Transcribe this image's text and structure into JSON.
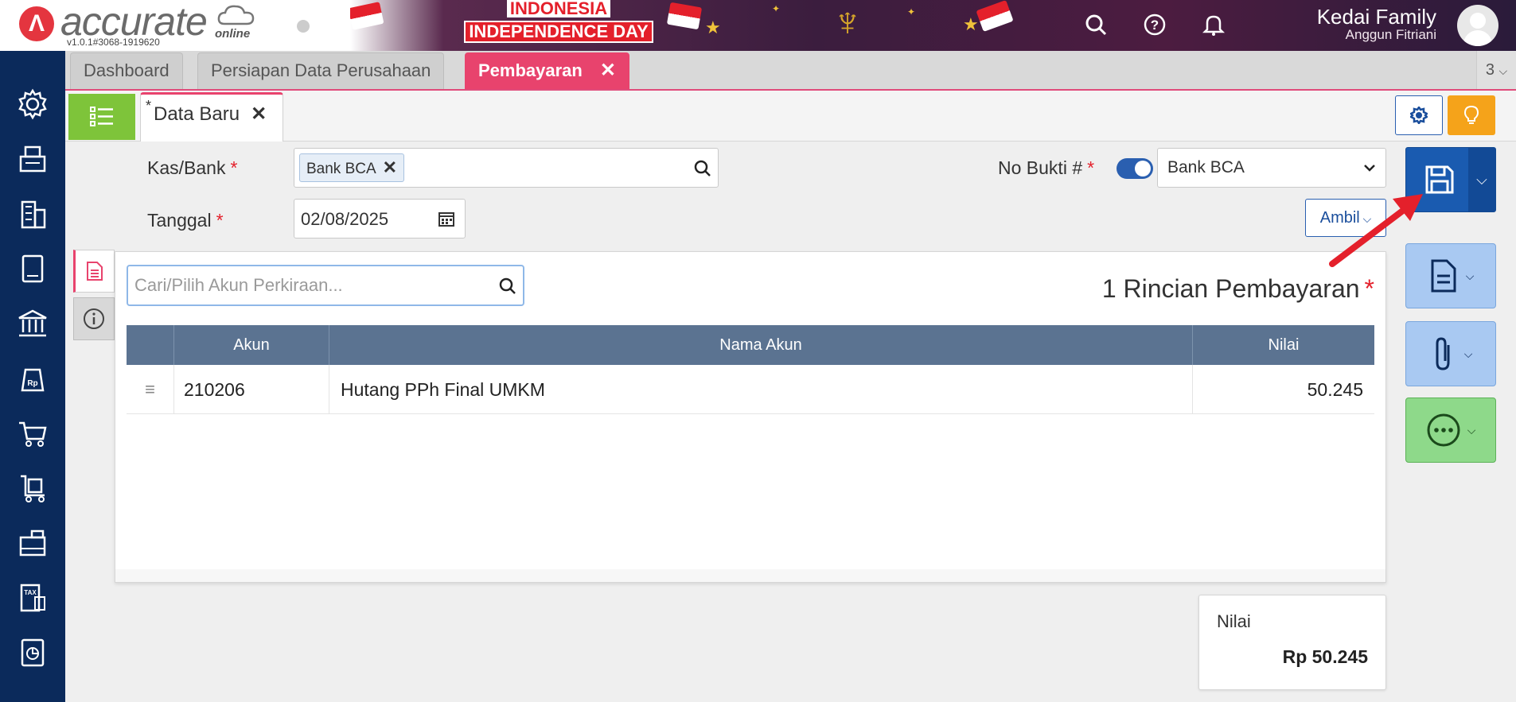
{
  "app": {
    "logo_text": "accurate",
    "logo_sub": "online",
    "version": "v1.0.1#3068-1919620"
  },
  "banner": {
    "line1": "INDONESIA",
    "line2": "INDEPENDENCE DAY"
  },
  "header": {
    "company": "Kedai Family",
    "user": "Anggun Fitriani"
  },
  "tabs": [
    {
      "label": "Dashboard"
    },
    {
      "label": "Persiapan Data Perusahaan"
    },
    {
      "label": "Pembayaran"
    }
  ],
  "tab_count": "3",
  "subtab": {
    "label": "Data Baru",
    "modified_mark": "*"
  },
  "form": {
    "kas_label": "Kas/Bank",
    "kas_value": "Bank BCA",
    "tanggal_label": "Tanggal",
    "tanggal_value": "02/08/2025",
    "nobukti_label": "No Bukti #",
    "nobukti_value": "Bank BCA",
    "required_mark": "*",
    "ambil_label": "Ambil"
  },
  "detail": {
    "search_placeholder": "Cari/Pilih Akun Perkiraan...",
    "title": "1 Rincian Pembayaran",
    "columns": [
      "Akun",
      "Nama Akun",
      "Nilai"
    ],
    "rows": [
      {
        "akun": "210206",
        "nama": "Hutang PPh Final UMKM",
        "nilai": "50.245"
      }
    ]
  },
  "total": {
    "label": "Nilai",
    "value": "Rp 50.245"
  },
  "colors": {
    "sidebar": "#0b2a5b",
    "accent_pink": "#e8436d",
    "save_blue": "#1a5bb0",
    "table_header": "#5b7391",
    "green": "#7ec43a"
  },
  "icons": {
    "sidebar": [
      "gear-icon",
      "fax-icon",
      "building-icon",
      "book-icon",
      "bank-icon",
      "price-tag-icon",
      "cart-icon",
      "trolley-icon",
      "warehouse-icon",
      "tax-icon",
      "report-icon"
    ]
  }
}
